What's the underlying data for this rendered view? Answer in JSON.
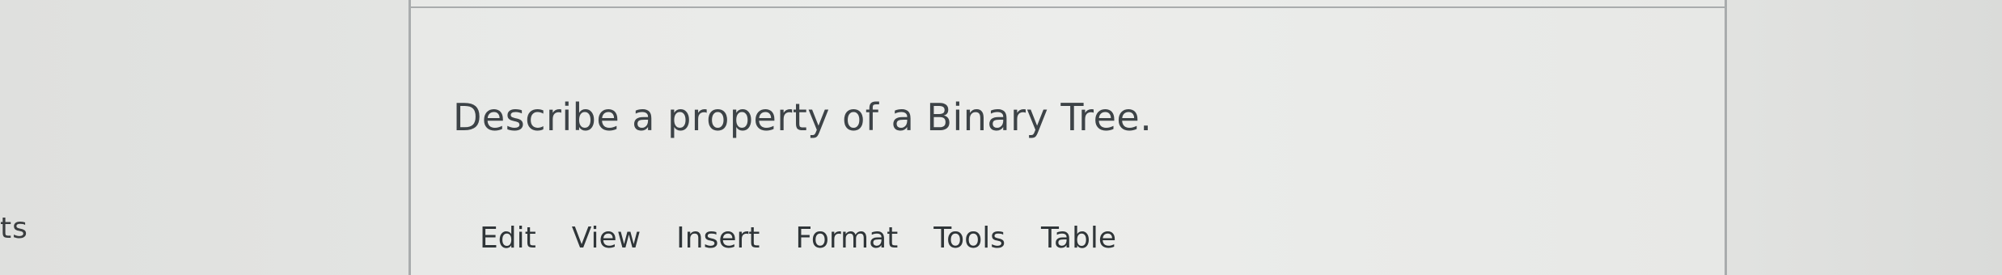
{
  "sidebar": {
    "partial_label": "ts"
  },
  "question": {
    "text": "Describe a property of a Binary Tree."
  },
  "editor": {
    "menu": [
      {
        "label": "Edit"
      },
      {
        "label": "View"
      },
      {
        "label": "Insert"
      },
      {
        "label": "Format"
      },
      {
        "label": "Tools"
      },
      {
        "label": "Table"
      }
    ]
  }
}
